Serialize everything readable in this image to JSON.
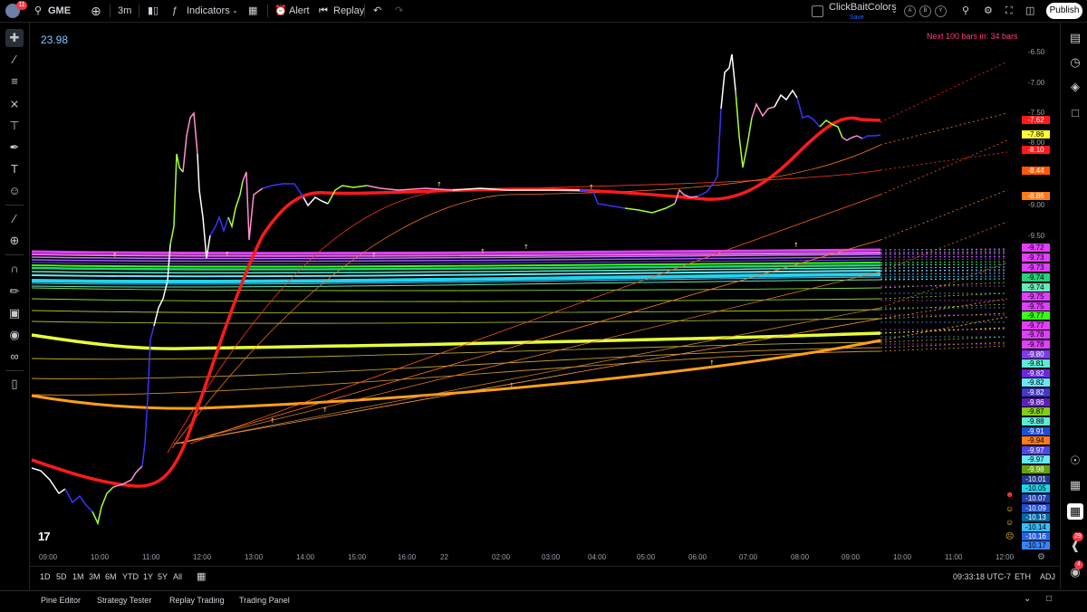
{
  "topbar": {
    "notification_count": "11",
    "symbol": "GME",
    "interval": "3m",
    "indicators_label": "Indicators",
    "alert_label": "Alert",
    "replay_label": "Replay",
    "layout_name": "ClickBaitColors",
    "layout_status": "Save",
    "compare_a": "A",
    "compare_b": "B",
    "compare_y": "Y",
    "publish_label": "Publish"
  },
  "chart": {
    "last_value": "23.98",
    "countdown_label": "Next 100 bars in: 34 bars",
    "accent_red": "#ff1a1a",
    "accent_cyan": "#22d3ee",
    "accent_yellow": "#e8ff3a",
    "accent_orange": "#ffa019",
    "accent_magenta": "#e040fb",
    "y_axis_ticks": [
      "-6.50",
      "-7.00",
      "-7.50",
      "-8.00",
      "-9.00",
      "-9.50"
    ],
    "price_labels": [
      {
        "text": "-7.62",
        "bg": "#ff1a1a",
        "fg": "#ffffff"
      },
      {
        "text": "-7.86",
        "bg": "#ffff33",
        "fg": "#000000"
      },
      {
        "text": "-8.10",
        "bg": "#ff1a1a",
        "fg": "#ffffff"
      },
      {
        "text": "-8.44",
        "bg": "#ff5a00",
        "fg": "#ffffff"
      },
      {
        "text": "-8.86",
        "bg": "#ff7a1a",
        "fg": "#ffffff"
      },
      {
        "text": "-9.72",
        "bg": "#e040fb",
        "fg": "#000000"
      },
      {
        "text": "-9.73",
        "bg": "#e040fb",
        "fg": "#000000"
      },
      {
        "text": "-9.73",
        "bg": "#e040fb",
        "fg": "#000000"
      },
      {
        "text": "-9.74",
        "bg": "#26d07c",
        "fg": "#000000"
      },
      {
        "text": "-9.74",
        "bg": "#6ee7b7",
        "fg": "#000000"
      },
      {
        "text": "-9.75",
        "bg": "#e040fb",
        "fg": "#000000"
      },
      {
        "text": "-9.75",
        "bg": "#e040fb",
        "fg": "#000000"
      },
      {
        "text": "-9.77",
        "bg": "#39ff14",
        "fg": "#000000"
      },
      {
        "text": "-9.77",
        "bg": "#e040fb",
        "fg": "#000000"
      },
      {
        "text": "-9.78",
        "bg": "#e040fb",
        "fg": "#000000"
      },
      {
        "text": "-9.78",
        "bg": "#e040fb",
        "fg": "#000000"
      },
      {
        "text": "-9.80",
        "bg": "#7c3aed",
        "fg": "#ffffff"
      },
      {
        "text": "-9.81",
        "bg": "#5eead4",
        "fg": "#000000"
      },
      {
        "text": "-9.82",
        "bg": "#6d28d9",
        "fg": "#ffffff"
      },
      {
        "text": "-9.82",
        "bg": "#67e8f9",
        "fg": "#000000"
      },
      {
        "text": "-9.82",
        "bg": "#4338ca",
        "fg": "#ffffff"
      },
      {
        "text": "-9.86",
        "bg": "#5b21b6",
        "fg": "#ffffff"
      },
      {
        "text": "-9.87",
        "bg": "#84cc16",
        "fg": "#000000"
      },
      {
        "text": "-9.88",
        "bg": "#5eead4",
        "fg": "#000000"
      },
      {
        "text": "-9.91",
        "bg": "#1d4ed8",
        "fg": "#ffffff"
      },
      {
        "text": "-9.94",
        "bg": "#ff7a1a",
        "fg": "#000000"
      },
      {
        "text": "-9.97",
        "bg": "#4f46e5",
        "fg": "#ffffff"
      },
      {
        "text": "-9.97",
        "bg": "#67e8f9",
        "fg": "#000000"
      },
      {
        "text": "-9.98",
        "bg": "#65a30d",
        "fg": "#ffffff"
      },
      {
        "text": "-10.01",
        "bg": "#1e3a8a",
        "fg": "#ffffff"
      },
      {
        "text": "-10.05",
        "bg": "#22d3ee",
        "fg": "#000000"
      },
      {
        "text": "-10.07",
        "bg": "#1e40af",
        "fg": "#ffffff"
      },
      {
        "text": "-10.09",
        "bg": "#1d4ed8",
        "fg": "#ffffff"
      },
      {
        "text": "-10.13",
        "bg": "#0369a1",
        "fg": "#ffffff"
      },
      {
        "text": "-10.14",
        "bg": "#38bdf8",
        "fg": "#000000"
      },
      {
        "text": "-10.16",
        "bg": "#2563eb",
        "fg": "#ffffff"
      },
      {
        "text": "-10.17",
        "bg": "#3b82f6",
        "fg": "#000000"
      }
    ],
    "x_axis_ticks": [
      "09:00",
      "10:00",
      "11:00",
      "12:00",
      "13:00",
      "14:00",
      "15:00",
      "16:00",
      "22",
      "02:00",
      "03:00",
      "04:00",
      "05:00",
      "06:00",
      "07:00",
      "08:00",
      "09:00",
      "10:00",
      "11:00",
      "12:00"
    ]
  },
  "rangebar": {
    "ranges": [
      "1D",
      "5D",
      "1M",
      "3M",
      "6M",
      "YTD",
      "1Y",
      "5Y",
      "All"
    ],
    "clock": "09:33:18 UTC-7",
    "session": "ETH",
    "adjust": "ADJ"
  },
  "bottombar": {
    "tabs": [
      "Pine Editor",
      "Strategy Tester",
      "Replay Trading",
      "Trading Panel"
    ]
  },
  "rightbar": {
    "badge_a": "29",
    "badge_b": "4"
  }
}
